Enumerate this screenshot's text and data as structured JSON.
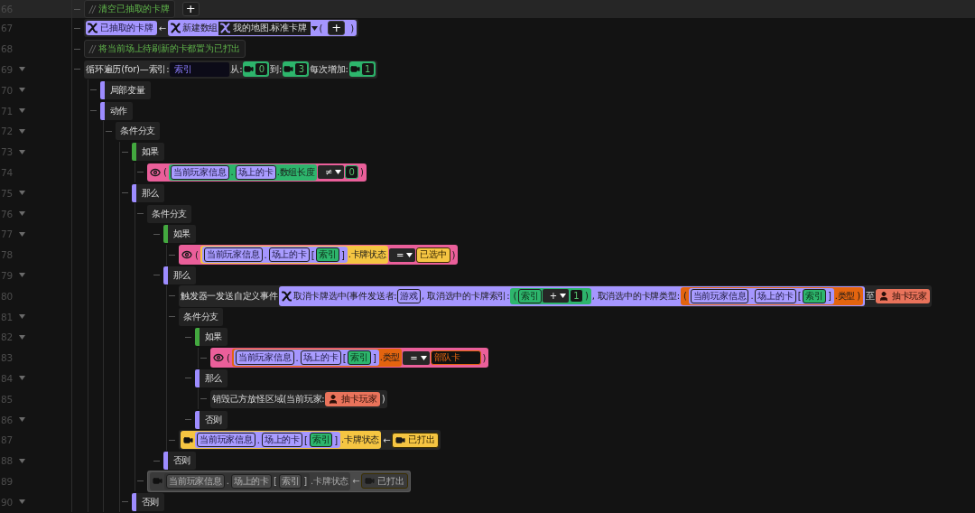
{
  "rows": [
    {
      "line": "66",
      "foldable": false,
      "disabled": false,
      "tokens": [
        {
          "kind": "comment",
          "slashes": "//",
          "text": "清空已抽取的卡牌"
        },
        {
          "kind": "button",
          "text": "+"
        }
      ]
    },
    {
      "line": "67",
      "foldable": false,
      "disabled": false,
      "tokens": [
        {
          "kind": "statement",
          "color": "#262626",
          "tokens": [
            {
              "kind": "var",
              "text": "已抽取的卡牌"
            },
            {
              "kind": "sym",
              "text": "←"
            },
            {
              "kind": "call",
              "color": "#a596ff",
              "tokens": [
                {
                  "kind": "text",
                  "text": "新建数组"
                },
                {
                  "kind": "darkvar",
                  "text": "我的地图.标准卡牌"
                },
                {
                  "kind": "caret"
                },
                {
                  "kind": "sym",
                  "text": "("
                },
                {
                  "kind": "button",
                  "text": "+"
                },
                {
                  "kind": "sym",
                  "text": ")"
                }
              ]
            }
          ]
        }
      ]
    },
    {
      "line": "68",
      "foldable": false,
      "disabled": false,
      "tokens": [
        {
          "kind": "comment",
          "slashes": "//",
          "text": "将当前场上待刷新的卡都置为已打出"
        }
      ]
    },
    {
      "line": "69",
      "foldable": true,
      "disabled": false,
      "tokens": [
        {
          "kind": "statement",
          "color": "#262626",
          "tokens": [
            {
              "kind": "text",
              "text": "循环遍历(for)—索引:"
            },
            {
              "kind": "input",
              "value": "索引"
            },
            {
              "kind": "text",
              "text": "从:"
            },
            {
              "kind": "counter",
              "text": "0"
            },
            {
              "kind": "text",
              "text": "到:"
            },
            {
              "kind": "counter",
              "text": "3"
            },
            {
              "kind": "text",
              "text": "每次增加:"
            },
            {
              "kind": "counter",
              "text": "1"
            }
          ]
        }
      ],
      "children": [
        {
          "line": "70",
          "foldable": true,
          "disabled": false,
          "tokens": [
            {
              "kind": "section",
              "text": "局部变量",
              "color": "#9d8cff"
            }
          ]
        },
        {
          "line": "71",
          "foldable": true,
          "disabled": false,
          "tokens": [
            {
              "kind": "section",
              "text": "动作",
              "color": "#9d8cff"
            }
          ],
          "children": [
            {
              "line": "72",
              "foldable": true,
              "disabled": false,
              "tokens": [
                {
                  "kind": "label",
                  "text": "条件分支"
                }
              ],
              "children": [
                {
                  "line": "73",
                  "foldable": true,
                  "disabled": false,
                  "tokens": [
                    {
                      "kind": "section",
                      "text": "如果",
                      "color": "#43a83f"
                    }
                  ],
                  "children": [
                    {
                      "line": "74",
                      "foldable": false,
                      "disabled": false,
                      "tokens": [
                        {
                          "kind": "condition",
                          "color": "#ea5f9a",
                          "tokens": [
                            {
                              "kind": "sym",
                              "text": "("
                            },
                            {
                              "kind": "access",
                              "color": "#2db56c",
                              "tokens": [
                                {
                                  "kind": "ref",
                                  "text": "当前玩家信息"
                                },
                                {
                                  "kind": "sym",
                                  "text": "."
                                },
                                {
                                  "kind": "ref",
                                  "text": "场上的卡"
                                },
                                {
                                  "kind": "text",
                                  "text": ".数组长度"
                                }
                              ]
                            },
                            {
                              "kind": "op",
                              "text": "≠"
                            },
                            {
                              "kind": "num",
                              "text": "0"
                            },
                            {
                              "kind": "sym",
                              "text": ")"
                            }
                          ]
                        }
                      ]
                    }
                  ]
                },
                {
                  "line": "75",
                  "foldable": true,
                  "disabled": false,
                  "tokens": [
                    {
                      "kind": "section",
                      "text": "那么",
                      "color": "#9d8cff"
                    }
                  ],
                  "children": [
                    {
                      "line": "76",
                      "foldable": true,
                      "disabled": false,
                      "tokens": [
                        {
                          "kind": "label",
                          "text": "条件分支"
                        }
                      ],
                      "children": [
                        {
                          "line": "77",
                          "foldable": true,
                          "disabled": false,
                          "tokens": [
                            {
                              "kind": "section",
                              "text": "如果",
                              "color": "#43a83f"
                            }
                          ],
                          "children": [
                            {
                              "line": "78",
                              "foldable": false,
                              "disabled": false,
                              "tokens": [
                                {
                                  "kind": "condition",
                                  "color": "#ea5f9a",
                                  "tokens": [
                                    {
                                      "kind": "sym",
                                      "text": "("
                                    },
                                    {
                                      "kind": "access",
                                      "color": "#f5c542",
                                      "tokens": [
                                        {
                                          "kind": "access",
                                          "color": "#a596ff",
                                          "tokens": [
                                            {
                                              "kind": "ref",
                                              "text": "当前玩家信息"
                                            },
                                            {
                                              "kind": "sym",
                                              "text": "."
                                            },
                                            {
                                              "kind": "ref",
                                              "text": "场上的卡"
                                            },
                                            {
                                              "kind": "sym",
                                              "text": "["
                                            },
                                            {
                                              "kind": "idx",
                                              "text": "索引"
                                            },
                                            {
                                              "kind": "sym",
                                              "text": "]"
                                            }
                                          ]
                                        },
                                        {
                                          "kind": "text",
                                          "text": ".卡牌状态"
                                        }
                                      ]
                                    },
                                    {
                                      "kind": "op",
                                      "text": "="
                                    },
                                    {
                                      "kind": "lit",
                                      "color": "#f5c542",
                                      "text": "已选中"
                                    },
                                    {
                                      "kind": "sym",
                                      "text": ")"
                                    }
                                  ]
                                }
                              ]
                            }
                          ]
                        },
                        {
                          "line": "79",
                          "foldable": true,
                          "disabled": false,
                          "tokens": [
                            {
                              "kind": "section",
                              "text": "那么",
                              "color": "#9d8cff"
                            }
                          ],
                          "children": [
                            {
                              "line": "80",
                              "foldable": false,
                              "disabled": false,
                              "tokens": [
                                {
                                  "kind": "statement",
                                  "color": "#262626",
                                  "tokens": [
                                    {
                                      "kind": "text",
                                      "text": "触发器一发送自定义事件"
                                    },
                                    {
                                      "kind": "call",
                                      "color": "#a596ff",
                                      "tokens": [
                                        {
                                          "kind": "text",
                                          "text": "取消卡牌选中(事件发送者:"
                                        },
                                        {
                                          "kind": "ref",
                                          "text": "游戏"
                                        },
                                        {
                                          "kind": "text",
                                          "text": ", 取消选中的卡牌索引:"
                                        },
                                        {
                                          "kind": "access",
                                          "color": "#2db56c",
                                          "tokens": [
                                            {
                                              "kind": "sym",
                                              "text": "("
                                            },
                                            {
                                              "kind": "idx",
                                              "text": "索引"
                                            },
                                            {
                                              "kind": "op",
                                              "text": "+"
                                            },
                                            {
                                              "kind": "num",
                                              "text": "1"
                                            },
                                            {
                                              "kind": "sym",
                                              "text": ")"
                                            }
                                          ]
                                        },
                                        {
                                          "kind": "text",
                                          "text": ", 取消选中的卡牌类型:"
                                        },
                                        {
                                          "kind": "access",
                                          "color": "#e3640f",
                                          "tokens": [
                                            {
                                              "kind": "sym",
                                              "text": "("
                                            },
                                            {
                                              "kind": "access",
                                              "color": "#a596ff",
                                              "tokens": [
                                                {
                                                  "kind": "ref",
                                                  "text": "当前玩家信息"
                                                },
                                                {
                                                  "kind": "sym",
                                                  "text": "."
                                                },
                                                {
                                                  "kind": "ref",
                                                  "text": "场上的卡"
                                                },
                                                {
                                                  "kind": "sym",
                                                  "text": "["
                                                },
                                                {
                                                  "kind": "idx",
                                                  "text": "索引"
                                                },
                                                {
                                                  "kind": "sym",
                                                  "text": "]"
                                                }
                                              ]
                                            },
                                            {
                                              "kind": "text",
                                              "text": ".类型"
                                            },
                                            {
                                              "kind": "sym",
                                              "text": ")"
                                            }
                                          ]
                                        }
                                      ]
                                    },
                                    {
                                      "kind": "text",
                                      "text": "至"
                                    },
                                    {
                                      "kind": "player",
                                      "text": "抽卡玩家"
                                    }
                                  ]
                                }
                              ]
                            },
                            {
                              "line": "81",
                              "foldable": true,
                              "disabled": false,
                              "tokens": [
                                {
                                  "kind": "label",
                                  "text": "条件分支"
                                }
                              ],
                              "children": [
                                {
                                  "line": "82",
                                  "foldable": true,
                                  "disabled": false,
                                  "tokens": [
                                    {
                                      "kind": "section",
                                      "text": "如果",
                                      "color": "#43a83f"
                                    }
                                  ],
                                  "children": [
                                    {
                                      "line": "83",
                                      "foldable": false,
                                      "disabled": false,
                                      "tokens": [
                                        {
                                          "kind": "condition",
                                          "color": "#ea5f9a",
                                          "tokens": [
                                            {
                                              "kind": "sym",
                                              "text": "("
                                            },
                                            {
                                              "kind": "access",
                                              "color": "#e3640f",
                                              "tokens": [
                                                {
                                                  "kind": "access",
                                                  "color": "#a596ff",
                                                  "tokens": [
                                                    {
                                                      "kind": "ref",
                                                      "text": "当前玩家信息"
                                                    },
                                                    {
                                                      "kind": "sym",
                                                      "text": "."
                                                    },
                                                    {
                                                      "kind": "ref",
                                                      "text": "场上的卡"
                                                    },
                                                    {
                                                      "kind": "sym",
                                                      "text": "["
                                                    },
                                                    {
                                                      "kind": "idx",
                                                      "text": "索引"
                                                    },
                                                    {
                                                      "kind": "sym",
                                                      "text": "]"
                                                    }
                                                  ]
                                                },
                                                {
                                                  "kind": "text",
                                                  "text": ".类型"
                                                }
                                              ]
                                            },
                                            {
                                              "kind": "op",
                                              "text": "="
                                            },
                                            {
                                              "kind": "enum",
                                              "color": "#e3640f",
                                              "text": "部队卡"
                                            },
                                            {
                                              "kind": "sym",
                                              "text": ")"
                                            }
                                          ]
                                        }
                                      ]
                                    }
                                  ]
                                },
                                {
                                  "line": "84",
                                  "foldable": true,
                                  "disabled": false,
                                  "tokens": [
                                    {
                                      "kind": "section",
                                      "text": "那么",
                                      "color": "#9d8cff"
                                    }
                                  ],
                                  "children": [
                                    {
                                      "line": "85",
                                      "foldable": false,
                                      "disabled": false,
                                      "tokens": [
                                        {
                                          "kind": "statement",
                                          "color": "#262626",
                                          "tokens": [
                                            {
                                              "kind": "text",
                                              "text": "销毁己方放怪区域(当前玩家:"
                                            },
                                            {
                                              "kind": "player",
                                              "text": "抽卡玩家"
                                            },
                                            {
                                              "kind": "sym",
                                              "text": ")"
                                            }
                                          ]
                                        }
                                      ]
                                    }
                                  ]
                                },
                                {
                                  "line": "86",
                                  "foldable": true,
                                  "disabled": false,
                                  "tokens": [
                                    {
                                      "kind": "section",
                                      "text": "否则",
                                      "color": "#9d8cff"
                                    }
                                  ]
                                }
                              ]
                            },
                            {
                              "line": "87",
                              "foldable": false,
                              "disabled": false,
                              "tokens": [
                                {
                                  "kind": "statement",
                                  "color": "#262626",
                                  "tokens": [
                                    {
                                      "kind": "target",
                                      "color": "#f5c542",
                                      "tokens": [
                                        {
                                          "kind": "access",
                                          "color": "#a596ff",
                                          "tokens": [
                                            {
                                              "kind": "ref",
                                              "text": "当前玩家信息"
                                            },
                                            {
                                              "kind": "sym",
                                              "text": "."
                                            },
                                            {
                                              "kind": "ref",
                                              "text": "场上的卡"
                                            },
                                            {
                                              "kind": "sym",
                                              "text": "["
                                            },
                                            {
                                              "kind": "idx",
                                              "text": "索引"
                                            },
                                            {
                                              "kind": "sym",
                                              "text": "]"
                                            }
                                          ]
                                        },
                                        {
                                          "kind": "text",
                                          "text": ".卡牌状态"
                                        }
                                      ]
                                    },
                                    {
                                      "kind": "sym",
                                      "text": "←"
                                    },
                                    {
                                      "kind": "status",
                                      "color": "#f5c542",
                                      "text": "已打出"
                                    }
                                  ]
                                }
                              ]
                            }
                          ]
                        },
                        {
                          "line": "88",
                          "foldable": true,
                          "disabled": false,
                          "tokens": [
                            {
                              "kind": "section",
                              "text": "否则",
                              "color": "#9d8cff"
                            }
                          ]
                        }
                      ]
                    },
                    {
                      "line": "89",
                      "foldable": false,
                      "disabled": true,
                      "tokens": [
                        {
                          "kind": "statement",
                          "color": "#4a4a4a",
                          "tokens": [
                            {
                              "kind": "target",
                              "color": "#3a3a3a",
                              "tokens": [
                                {
                                  "kind": "access",
                                  "color": "#333333",
                                  "tokens": [
                                    {
                                      "kind": "ref",
                                      "text": "当前玩家信息"
                                    },
                                    {
                                      "kind": "sym",
                                      "text": "."
                                    },
                                    {
                                      "kind": "ref",
                                      "text": "场上的卡"
                                    },
                                    {
                                      "kind": "sym",
                                      "text": "["
                                    },
                                    {
                                      "kind": "idx",
                                      "text": "索引"
                                    },
                                    {
                                      "kind": "sym",
                                      "text": "]"
                                    }
                                  ]
                                },
                                {
                                  "kind": "text",
                                  "text": ".卡牌状态"
                                }
                              ]
                            },
                            {
                              "kind": "sym",
                              "text": "←"
                            },
                            {
                              "kind": "status",
                              "color": "#3a3a3a",
                              "text": "已打出"
                            }
                          ]
                        }
                      ]
                    }
                  ]
                },
                {
                  "line": "90",
                  "foldable": true,
                  "disabled": false,
                  "tokens": [
                    {
                      "kind": "section",
                      "text": "否则",
                      "color": "#9d8cff"
                    }
                  ]
                }
              ]
            }
          ]
        }
      ]
    }
  ]
}
